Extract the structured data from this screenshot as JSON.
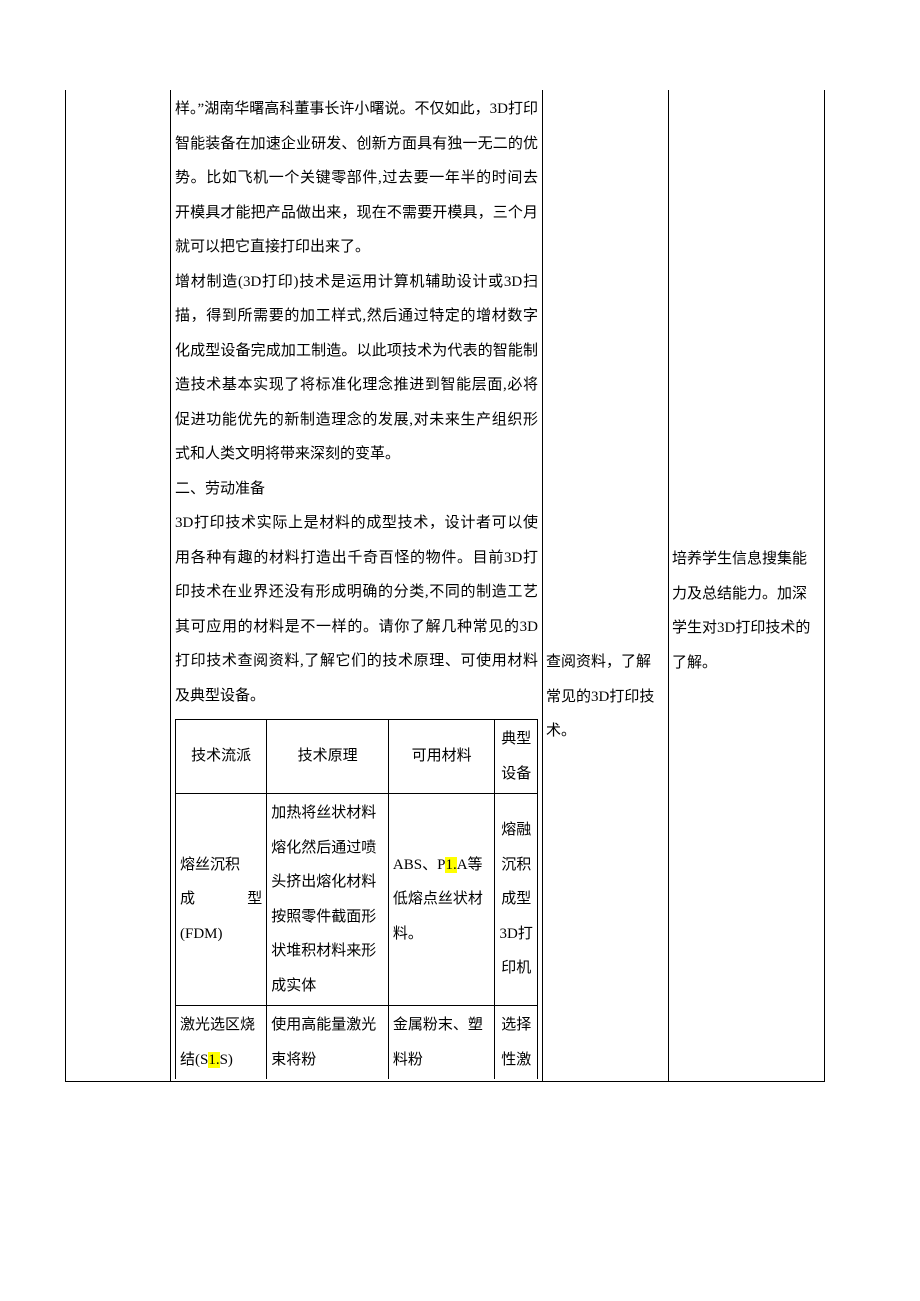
{
  "main": {
    "p1": "样。”湖南华曙高科董事长许小曙说。不仅如此，3D打印智能装备在加速企业研发、创新方面具有独一无二的优势。比如飞机一个关键零部件,过去要一年半的时间去开模具才能把产品做出来，现在不需要开模具，三个月就可以把它直接打印出来了。",
    "p2": "增材制造(3D打印)技术是运用计算机辅助设计或3D扫描，得到所需要的加工样式,然后通过特定的增材数字化成型设备完成加工制造。以此项技术为代表的智能制造技术基本实现了将标准化理念推进到智能层面,必将促进功能优先的新制造理念的发展,对未来生产组织形式和人类文明将带来深刻的变革。",
    "section2_title": "二、劳动准备",
    "p3": "3D打印技术实际上是材料的成型技术，设计者可以使用各种有趣的材料打造出千奇百怪的物件。目前3D打印技术在业界还没有形成明确的分类,不同的制造工艺其可应用的材料是不一样的。请你了解几种常见的3D打印技术查阅资料,了解它们的技术原理、可使用材料及典型设备。"
  },
  "student": {
    "s1": "查阅资料，了解常见的3D打印技术。"
  },
  "intent": {
    "i1": "培养学生信息搜集能力及总结能力。加深学生对3D打印技术的了解。"
  },
  "table": {
    "headers": {
      "c1": "技术流派",
      "c2": "技术原理",
      "c3": "可用材料",
      "c4": "典型设备"
    },
    "row1": {
      "name_l1": "熔丝沉积",
      "name_l2a": "成",
      "name_l2b": "型",
      "name_l3": "(FDM)",
      "principle": "加热将丝状材料熔化然后通过喷头挤出熔化材料按照零件截面形状堆积材料来形成实体",
      "material_a": "ABS、P",
      "material_hl": "1.",
      "material_b": "A等低熔点丝状材料。",
      "device": "熔融沉积成型3D打印机"
    },
    "row2": {
      "name_a": "激光选区烧结(S",
      "name_hl": "1.",
      "name_b": "S)",
      "principle": "使用高能量激光束将粉",
      "material": "金属粉末、塑料粉",
      "device": "选择性激"
    }
  }
}
